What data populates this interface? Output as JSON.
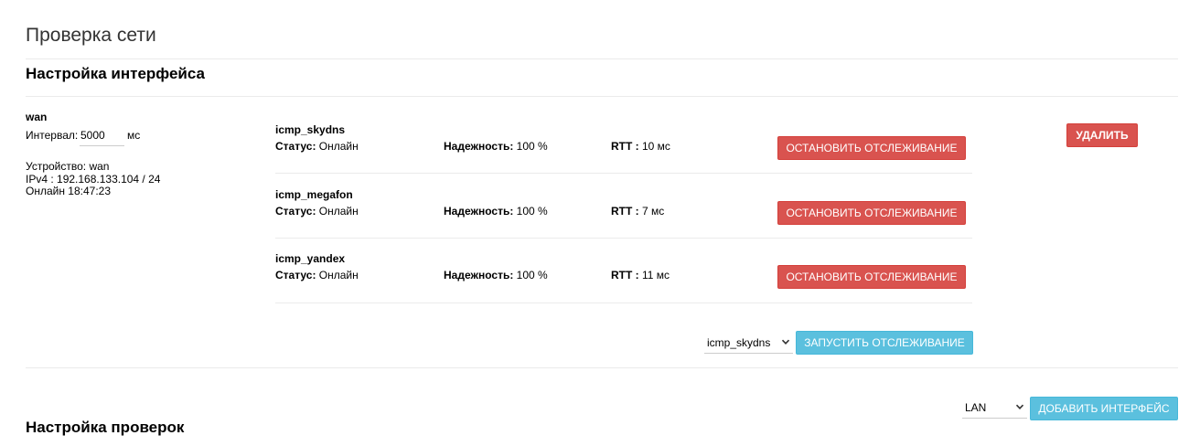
{
  "page": {
    "title": "Проверка сети"
  },
  "interfaces_section": {
    "title": "Настройка интерфейса"
  },
  "interface": {
    "name": "wan",
    "interval_label": "Интервал:",
    "interval_value": "5000",
    "interval_unit": "мс",
    "device_line": "Устройство: wan",
    "ipv4_line": "IPv4 : 192.168.133.104 / 24",
    "online_line": "Онлайн 18:47:23",
    "delete_label": "УДАЛИТЬ"
  },
  "monitors": [
    {
      "name": "icmp_skydns",
      "status_label": "Статус:",
      "status_value": " Онлайн",
      "reliability_label": "Надежность:",
      "reliability_value": " 100 %",
      "rtt_label": "RTT :",
      "rtt_value": " 10 мс",
      "stop_label": "ОСТАНОВИТЬ ОТСЛЕЖИВАНИЕ"
    },
    {
      "name": "icmp_megafon",
      "status_label": "Статус:",
      "status_value": " Онлайн",
      "reliability_label": "Надежность:",
      "reliability_value": " 100 %",
      "rtt_label": "RTT :",
      "rtt_value": " 7 мс",
      "stop_label": "ОСТАНОВИТЬ ОТСЛЕЖИВАНИЕ"
    },
    {
      "name": "icmp_yandex",
      "status_label": "Статус:",
      "status_value": " Онлайн",
      "reliability_label": "Надежность:",
      "reliability_value": " 100 %",
      "rtt_label": "RTT :",
      "rtt_value": " 11 мс",
      "stop_label": "ОСТАНОВИТЬ ОТСЛЕЖИВАНИЕ"
    }
  ],
  "add_monitor": {
    "selected": "icmp_skydns",
    "start_label": "ЗАПУСТИТЬ ОТСЛЕЖИВАНИЕ"
  },
  "add_interface": {
    "selected": "LAN",
    "add_label": "ДОБАВИТЬ ИНТЕРФЕЙС"
  },
  "checks_section": {
    "title": "Настройка проверок"
  },
  "colors": {
    "danger": "#d9534f",
    "info": "#5bc0de",
    "divider": "#ebebeb"
  },
  "icons": {
    "select_arrow": "chevron-down-icon"
  }
}
